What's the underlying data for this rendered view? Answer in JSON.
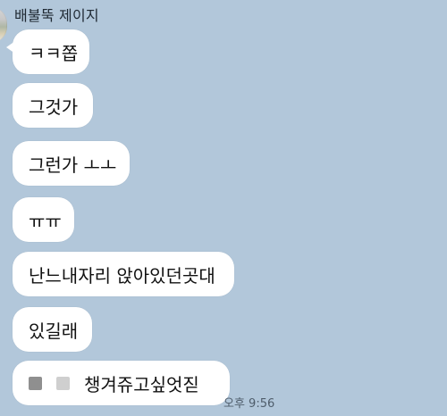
{
  "chat": {
    "sender_name": "배불뚝 제이지",
    "messages": [
      "ㅋㅋ쫍",
      "그것가",
      "그런가 ㅗㅗ",
      "ㅠㅠ",
      "난느내자리 앉아있던곳대",
      "있길래",
      "챙겨쥬고싶엇짇"
    ],
    "last_message_emoji": [
      "gray-square-emoji",
      "light-gray-square-emoji"
    ],
    "timestamp": "오후 9:56"
  },
  "colors": {
    "chat_background": "#b2c7da",
    "bubble_background": "#ffffff",
    "text": "#111111"
  }
}
